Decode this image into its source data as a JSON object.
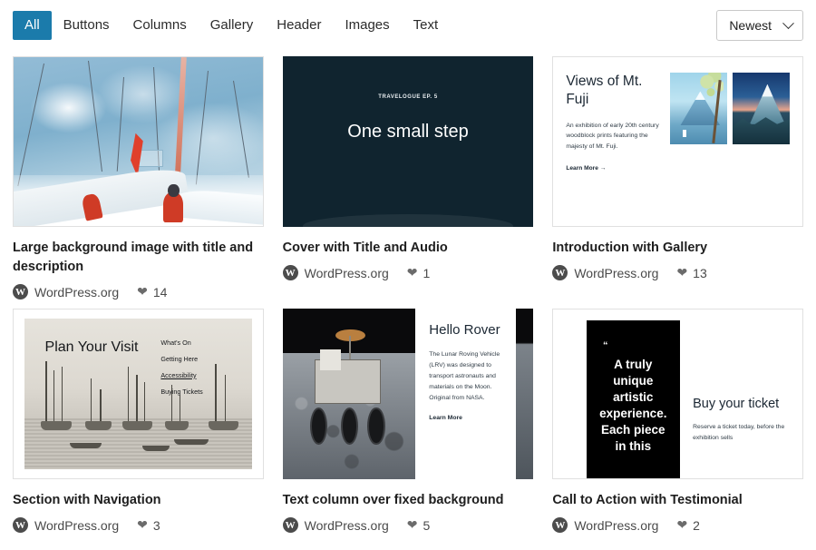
{
  "topbar": {
    "tabs": [
      {
        "label": "All",
        "active": true
      },
      {
        "label": "Buttons",
        "active": false
      },
      {
        "label": "Columns",
        "active": false
      },
      {
        "label": "Gallery",
        "active": false
      },
      {
        "label": "Header",
        "active": false
      },
      {
        "label": "Images",
        "active": false
      },
      {
        "label": "Text",
        "active": false
      }
    ],
    "sort": {
      "value": "Newest",
      "icon": "chevron-down-icon"
    }
  },
  "colors": {
    "accent": "#1b7bab",
    "card_border": "#e0e0e0",
    "text": "#1e1e1e",
    "muted": "#4a4a4a",
    "cover_dark": "#10242f",
    "quote_black": "#000000"
  },
  "author_icon": "wordpress-logo-icon",
  "like_icon": "heart-icon",
  "patterns": [
    {
      "title": "Large background image with title and description",
      "author": "WordPress.org",
      "likes": "14",
      "preview": {
        "kind": "watercolor-sailboats"
      }
    },
    {
      "title": "Cover with Title and Audio",
      "author": "WordPress.org",
      "likes": "1",
      "preview": {
        "kind": "cover-dark",
        "eyebrow": "TRAVELOGUE EP. 5",
        "heading": "One small step"
      }
    },
    {
      "title": "Introduction with Gallery",
      "author": "WordPress.org",
      "likes": "13",
      "preview": {
        "kind": "fuji-gallery",
        "heading": "Views of Mt. Fuji",
        "body": "An exhibition of early 20th century woodblock prints featuring the majesty of Mt. Fuji.",
        "link": "Learn More →"
      }
    },
    {
      "title": "Section with Navigation",
      "author": "WordPress.org",
      "likes": "3",
      "preview": {
        "kind": "engraving-nav",
        "heading": "Plan Your Visit",
        "nav": [
          "What's On",
          "Getting Here",
          "Accessibility",
          "Buying Tickets"
        ],
        "nav_underlined": "Accessibility"
      }
    },
    {
      "title": "Text column over fixed background",
      "author": "WordPress.org",
      "likes": "5",
      "preview": {
        "kind": "rover-column",
        "heading": "Hello Rover",
        "body": "The Lunar Roving Vehicle (LRV) was designed to transport astronauts and materials on the Moon. Original from NASA.",
        "link": "Learn More"
      }
    },
    {
      "title": "Call to Action with Testimonial",
      "author": "WordPress.org",
      "likes": "2",
      "preview": {
        "kind": "cta-testimonial",
        "quote_mark": "“",
        "quote": "A truly unique artistic experience. Each piece in this",
        "heading": "Buy your ticket",
        "body": "Reserve a ticket today, before the exhibition sells"
      }
    }
  ]
}
